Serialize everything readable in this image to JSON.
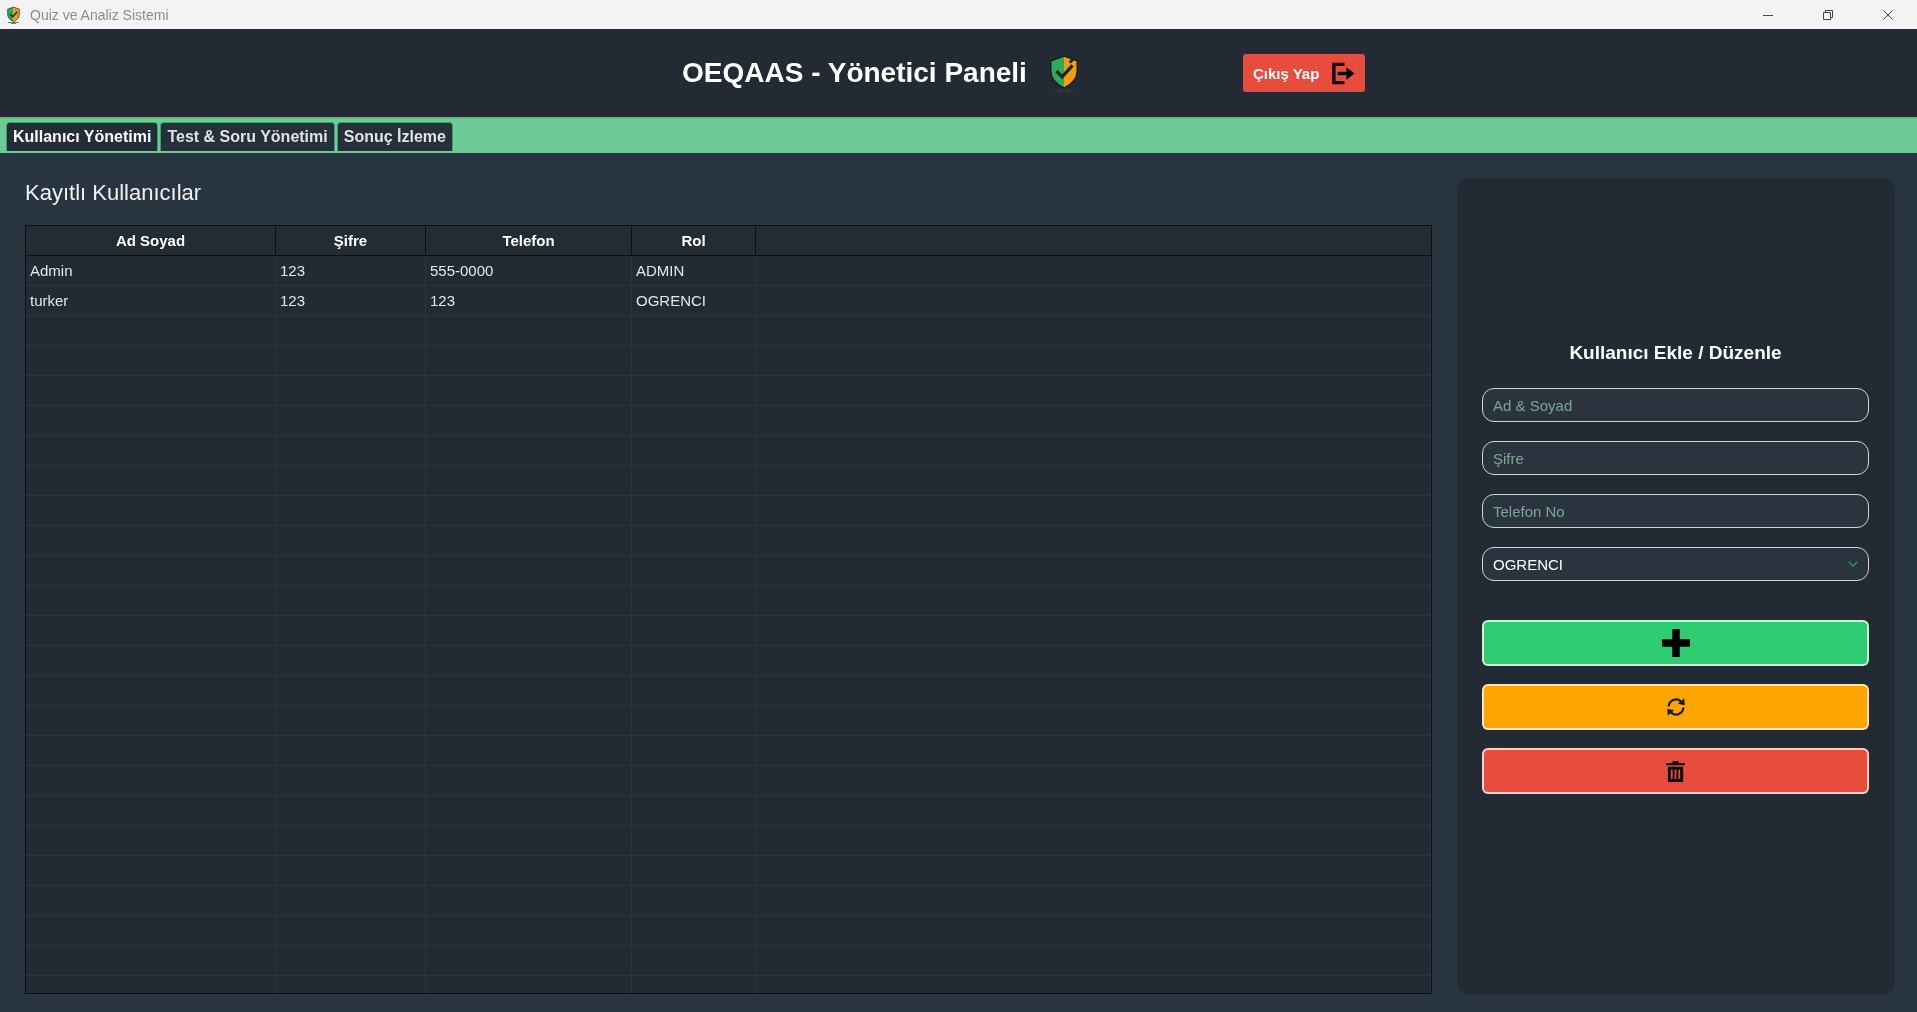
{
  "window": {
    "title": "Quiz ve Analiz Sistemi"
  },
  "header": {
    "title": "OEQAAS - Yönetici Paneli",
    "logout_button": "Çıkış Yap"
  },
  "tabs": [
    {
      "label": "Kullanıcı Yönetimi",
      "selected": true
    },
    {
      "label": "Test & Soru Yönetimi",
      "selected": false
    },
    {
      "label": "Sonuç İzleme",
      "selected": false
    }
  ],
  "users_table": {
    "title": "Kayıtlı Kullanıcılar",
    "columns": [
      "Ad Soyad",
      "Şifre",
      "Telefon",
      "Rol"
    ],
    "rows": [
      [
        "Admin",
        "123",
        "555-0000",
        "ADMIN"
      ],
      [
        "turker",
        "123",
        "123",
        "OGRENCI"
      ]
    ]
  },
  "user_form": {
    "title": "Kullanıcı Ekle / Düzenle",
    "fields": [
      {
        "placeholder": "Ad & Soyad"
      },
      {
        "placeholder": "Şifre"
      },
      {
        "placeholder": "Telefon No"
      }
    ],
    "role_select": {
      "value": "OGRENCI"
    },
    "buttons": [
      {
        "kind": "add"
      },
      {
        "kind": "update"
      },
      {
        "kind": "delete"
      }
    ]
  }
}
